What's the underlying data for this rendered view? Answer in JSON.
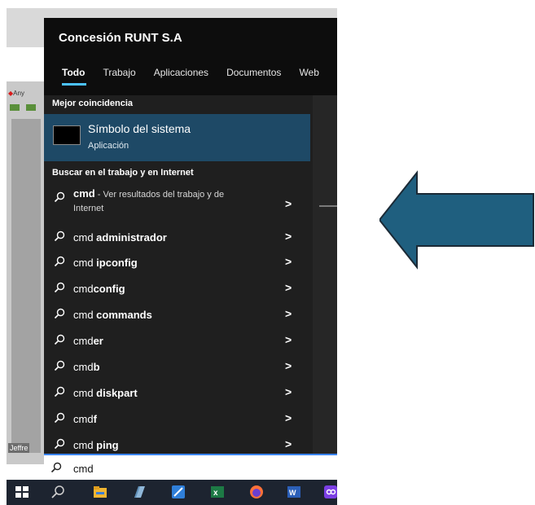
{
  "window": {
    "title": "Concesión RUNT S.A"
  },
  "tabs": [
    {
      "label": "Todo"
    },
    {
      "label": "Trabajo"
    },
    {
      "label": "Aplicaciones"
    },
    {
      "label": "Documentos"
    },
    {
      "label": "Web"
    }
  ],
  "sections": {
    "best_match": "Mejor coincidencia",
    "search_work_web": "Buscar en el trabajo y en Internet"
  },
  "best_match": {
    "name": "Símbolo del sistema",
    "kind": "Aplicación"
  },
  "suggestions": [
    {
      "prefix": "cmd",
      "bold": "",
      "note_line1": " - Ver resultados del trabajo y de",
      "note_line2": "Internet"
    },
    {
      "prefix": "cmd ",
      "bold": "administrador"
    },
    {
      "prefix": "cmd ",
      "bold": "ipconfig"
    },
    {
      "prefix": "cmd",
      "bold": "config"
    },
    {
      "prefix": "cmd ",
      "bold": "commands"
    },
    {
      "prefix": "cmd",
      "bold": "er"
    },
    {
      "prefix": "cmd",
      "bold": "b"
    },
    {
      "prefix": "cmd ",
      "bold": "diskpart"
    },
    {
      "prefix": "cmd",
      "bold": "f"
    },
    {
      "prefix": "cmd ",
      "bold": "ping"
    }
  ],
  "chevron": ">",
  "search": {
    "value": "cmd"
  },
  "background": {
    "any_text": "Any",
    "jeffre_text": "Jeffre"
  },
  "colors": {
    "menu_bg": "#1f1f1f",
    "highlight": "#1e4966",
    "accent": "#4cc2ff",
    "arrow_fill": "#1f5f7f",
    "taskbar": "#1d2430"
  }
}
